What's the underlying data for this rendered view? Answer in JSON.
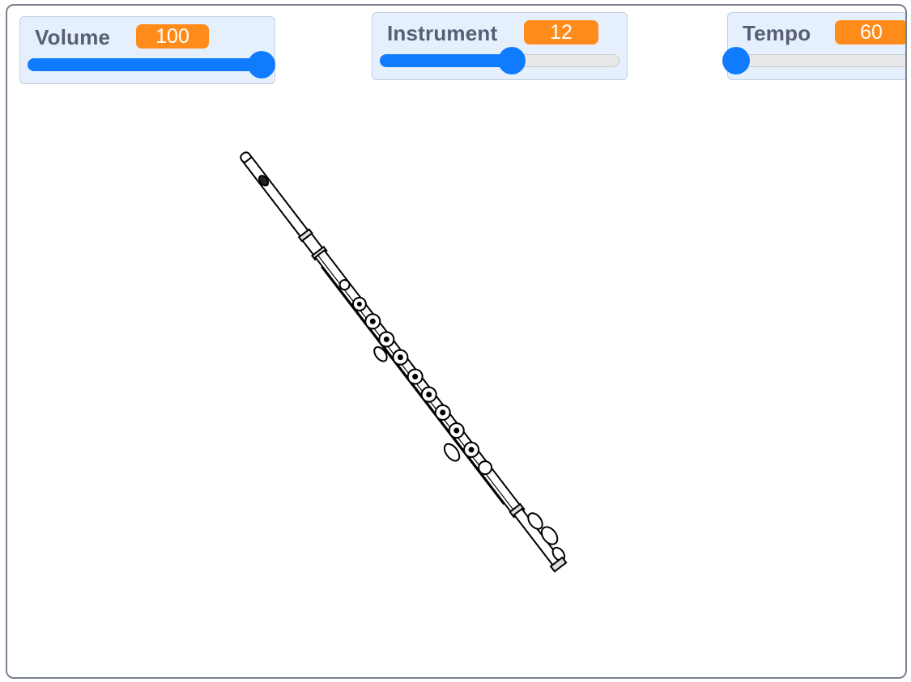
{
  "monitors": {
    "volume": {
      "label": "Volume",
      "value": "100",
      "min": 0,
      "max": 100,
      "level": 100
    },
    "instrument": {
      "label": "Instrument",
      "value": "12",
      "min": 1,
      "max": 21,
      "level": 12
    },
    "tempo": {
      "label": "Tempo",
      "value": "60",
      "min": 60,
      "max": 200,
      "level": 60
    }
  },
  "sprite": {
    "name": "flute",
    "icon": "flute-icon"
  },
  "colors": {
    "monitor_bg": "#e6f0fc",
    "value_badge": "#ff8c1a",
    "slider_blue": "#0f7cff",
    "label_text": "#575e75",
    "stage_border": "#7a8190"
  }
}
